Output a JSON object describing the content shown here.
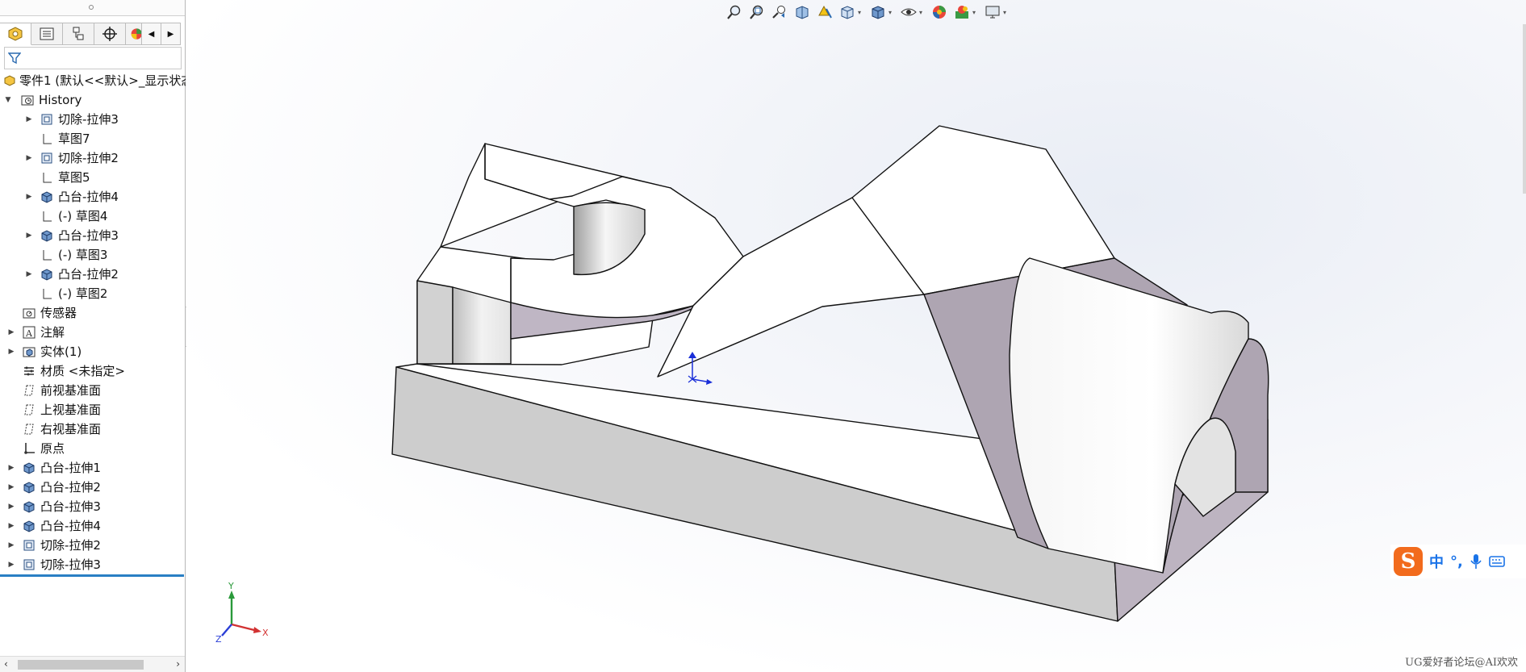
{
  "feature_manager": {
    "tabs": [
      {
        "name": "feature-manager-tab",
        "icon": "part-feature-icon"
      },
      {
        "name": "property-manager-tab",
        "icon": "property-list-icon"
      },
      {
        "name": "configuration-manager-tab",
        "icon": "configuration-icon"
      },
      {
        "name": "dimxpert-tab",
        "icon": "crosshair-icon"
      },
      {
        "name": "display-manager-tab",
        "icon": "color-wheel-icon"
      }
    ],
    "filter_icon": "funnel-icon",
    "root_label": "零件1 (默认<<默认>_显示状态",
    "history_label": "History",
    "history_items": [
      {
        "label": "切除-拉伸3",
        "icon": "cut-extrude-icon",
        "expandable": true
      },
      {
        "label": "草图7",
        "icon": "sketch-icon",
        "expandable": false
      },
      {
        "label": "切除-拉伸2",
        "icon": "cut-extrude-icon",
        "expandable": true
      },
      {
        "label": "草图5",
        "icon": "sketch-icon",
        "expandable": false
      },
      {
        "label": "凸台-拉伸4",
        "icon": "boss-extrude-icon",
        "expandable": true
      },
      {
        "label": "(-) 草图4",
        "icon": "sketch-icon",
        "expandable": false
      },
      {
        "label": "凸台-拉伸3",
        "icon": "boss-extrude-icon",
        "expandable": true
      },
      {
        "label": "(-) 草图3",
        "icon": "sketch-icon",
        "expandable": false
      },
      {
        "label": "凸台-拉伸2",
        "icon": "boss-extrude-icon",
        "expandable": true
      },
      {
        "label": "(-) 草图2",
        "icon": "sketch-icon",
        "expandable": false
      }
    ],
    "top_items": [
      {
        "label": "传感器",
        "icon": "sensor-icon",
        "expandable": false
      },
      {
        "label": "注解",
        "icon": "annotation-icon",
        "expandable": true
      },
      {
        "label": "实体(1)",
        "icon": "solid-body-icon",
        "expandable": true
      },
      {
        "label": "材质 <未指定>",
        "icon": "material-icon",
        "expandable": false
      },
      {
        "label": "前视基准面",
        "icon": "plane-icon",
        "expandable": false
      },
      {
        "label": "上视基准面",
        "icon": "plane-icon",
        "expandable": false
      },
      {
        "label": "右视基准面",
        "icon": "plane-icon",
        "expandable": false
      },
      {
        "label": "原点",
        "icon": "origin-icon",
        "expandable": false
      },
      {
        "label": "凸台-拉伸1",
        "icon": "boss-extrude-icon",
        "expandable": true
      },
      {
        "label": "凸台-拉伸2",
        "icon": "boss-extrude-icon",
        "expandable": true
      },
      {
        "label": "凸台-拉伸3",
        "icon": "boss-extrude-icon",
        "expandable": true
      },
      {
        "label": "凸台-拉伸4",
        "icon": "boss-extrude-icon",
        "expandable": true
      },
      {
        "label": "切除-拉伸2",
        "icon": "cut-extrude-icon",
        "expandable": true
      },
      {
        "label": "切除-拉伸3",
        "icon": "cut-extrude-icon",
        "expandable": true
      }
    ]
  },
  "heads_up_toolbar": [
    {
      "name": "zoom-to-fit-button",
      "icon": "zoom-fit-icon"
    },
    {
      "name": "zoom-to-area-button",
      "icon": "zoom-area-icon"
    },
    {
      "name": "previous-view-button",
      "icon": "previous-view-icon"
    },
    {
      "name": "section-view-button",
      "icon": "section-view-icon"
    },
    {
      "name": "dynamic-annotation-button",
      "icon": "annotation-view-icon"
    },
    {
      "name": "view-orientation-button",
      "icon": "view-orientation-icon",
      "dropdown": true
    },
    {
      "name": "display-style-button",
      "icon": "display-style-icon",
      "dropdown": true
    },
    {
      "name": "hide-show-items-button",
      "icon": "eye-icon",
      "dropdown": true
    },
    {
      "name": "edit-appearance-button",
      "icon": "appearance-icon"
    },
    {
      "name": "apply-scene-button",
      "icon": "scene-icon",
      "dropdown": true
    },
    {
      "name": "view-settings-button",
      "icon": "monitor-icon",
      "dropdown": true
    }
  ],
  "triad": {
    "x_label": "X",
    "y_label": "Y",
    "z_label": "Z"
  },
  "ime": {
    "logo": "S",
    "mode": "中",
    "punct": "°,",
    "mic_icon": "microphone-icon",
    "keyboard_icon": "keyboard-icon"
  },
  "watermark": "UG爱好者论坛@AI欢欢",
  "colors": {
    "accent": "#2a7fc4",
    "face_light": "#f4f4f4",
    "face_mid": "#cbcbcb",
    "face_shadow": "#aea5b2",
    "origin_blue": "#1a2fd8"
  }
}
